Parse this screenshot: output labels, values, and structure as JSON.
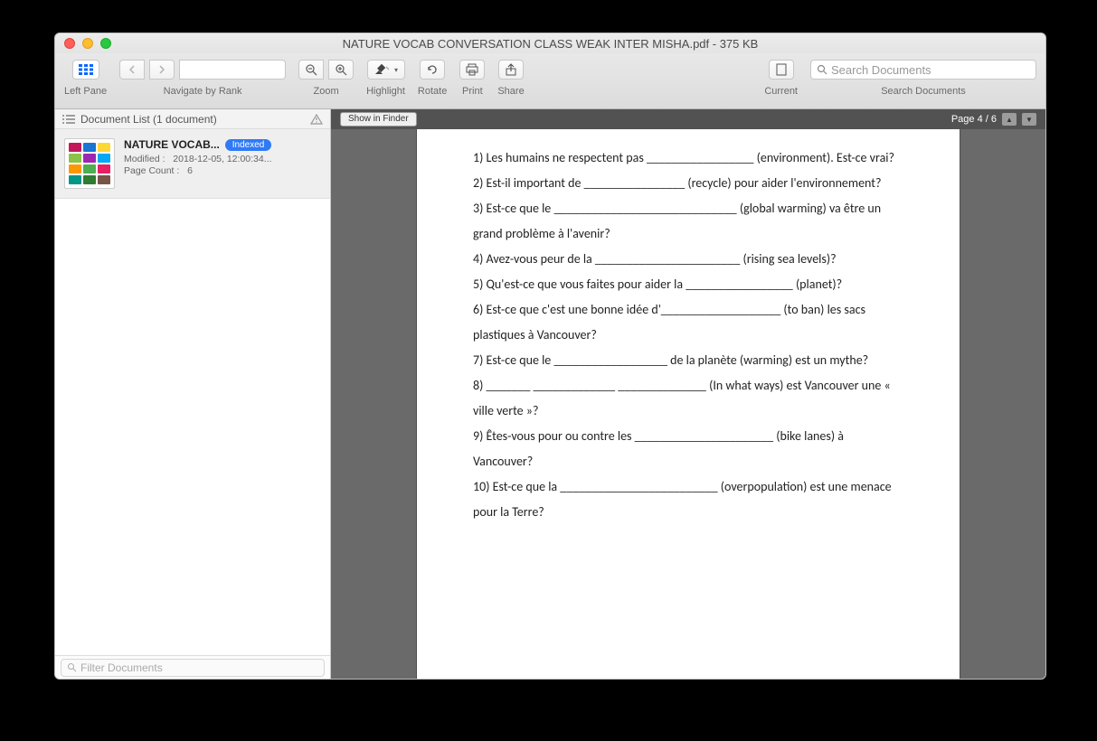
{
  "window": {
    "title": "NATURE VOCAB CONVERSATION CLASS WEAK INTER MISHA.pdf - 375 KB"
  },
  "toolbar": {
    "left_pane": "Left Pane",
    "navigate": "Navigate by Rank",
    "zoom": "Zoom",
    "highlight": "Highlight",
    "rotate": "Rotate",
    "print": "Print",
    "share": "Share",
    "current": "Current",
    "search_label": "Search Documents",
    "search_placeholder": "Search Documents"
  },
  "sidebar": {
    "header": "Document List (1 document)",
    "doc": {
      "title": "NATURE VOCAB...",
      "badge": "Indexed",
      "modified_label": "Modified :",
      "modified_value": "2018-12-05, 12:00:34...",
      "pagecount_label": "Page Count :",
      "pagecount_value": "6"
    },
    "filter_placeholder": "Filter Documents"
  },
  "viewer": {
    "show_in_finder": "Show in Finder",
    "page_indicator": "Page 4 / 6"
  },
  "document_lines": [
    "1) Les humains ne respectent pas _________________ (environment). Est-ce vrai?",
    "2) Est-il important de ________________ (recycle) pour aider l'environnement?",
    "3) Est-ce que le _____________________________ (global warming) va être un grand problème à l'avenir?",
    "4) Avez-vous peur de la _______________________ (rising sea levels)?",
    "5) Qu'est-ce que vous faites pour aider la _________________ (planet)?",
    "6) Est-ce que c'est une bonne idée d'___________________ (to ban) les sacs plastiques à Vancouver?",
    "7) Est-ce que le __________________ de la planète (warming) est un mythe?",
    "8) _______ _____________ ______________ (In what ways) est Vancouver une « ville verte »?",
    "9) Êtes-vous pour ou contre les ______________________ (bike lanes) à Vancouver?",
    "10) Est-ce que la _________________________ (overpopulation) est une menace pour la Terre?"
  ]
}
